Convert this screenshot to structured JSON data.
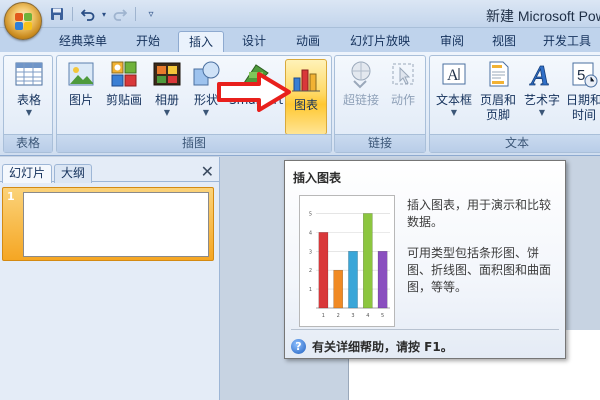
{
  "window": {
    "title": "新建 Microsoft PowerPoint 演示文稿",
    "title_visible": "新建 Microsoft Pow"
  },
  "quick_access": {
    "icons": [
      "save-icon",
      "undo-icon",
      "undo-dropdown-icon",
      "redo-icon",
      "customize-qat-icon"
    ]
  },
  "tabs": [
    {
      "label": "经典菜单"
    },
    {
      "label": "开始"
    },
    {
      "label": "插入",
      "active": true
    },
    {
      "label": "设计"
    },
    {
      "label": "动画"
    },
    {
      "label": "幻灯片放映"
    },
    {
      "label": "审阅"
    },
    {
      "label": "视图"
    },
    {
      "label": "开发工具"
    }
  ],
  "ribbon": {
    "groups": [
      {
        "label": "表格",
        "buttons": [
          {
            "label": "表格",
            "icon": "table-icon",
            "dropdown": true
          }
        ]
      },
      {
        "label": "插图",
        "buttons": [
          {
            "label": "图片",
            "icon": "picture-icon"
          },
          {
            "label": "剪贴画",
            "icon": "clipart-icon"
          },
          {
            "label": "相册",
            "icon": "photo-album-icon",
            "dropdown": true
          },
          {
            "label": "形状",
            "icon": "shapes-icon",
            "dropdown": true
          },
          {
            "label": "SmartArt",
            "icon": "smartart-icon"
          },
          {
            "label": "图表",
            "icon": "chart-icon",
            "highlighted": true
          }
        ]
      },
      {
        "label": "链接",
        "buttons": [
          {
            "label": "超链接",
            "icon": "hyperlink-icon",
            "disabled": true
          },
          {
            "label": "动作",
            "icon": "action-icon",
            "disabled": true
          }
        ]
      },
      {
        "label": "文本",
        "buttons": [
          {
            "label": "文本框",
            "icon": "textbox-icon",
            "dropdown": true
          },
          {
            "label": "页眉和",
            "label2": "页脚",
            "icon": "header-footer-icon"
          },
          {
            "label": "艺术字",
            "icon": "wordart-icon",
            "dropdown": true
          },
          {
            "label": "日期和",
            "label2": "时间",
            "icon": "date-time-icon"
          }
        ]
      }
    ]
  },
  "left_panel": {
    "tabs": [
      {
        "label": "幻灯片",
        "active": true
      },
      {
        "label": "大纲"
      }
    ],
    "close": "✕",
    "slides": [
      {
        "number": "1"
      }
    ]
  },
  "tooltip": {
    "title": "插入图表",
    "desc1": "插入图表，用于演示和比较数据。",
    "desc2": "可用类型包括条形图、饼图、折线图、面积图和曲面图，等等。",
    "help": "有关详细帮助，请按 F1。",
    "help_icon": "?",
    "preview_chart": {
      "type": "bar",
      "categories": [
        "1",
        "2",
        "3",
        "4",
        "5"
      ],
      "values": [
        4,
        2,
        3,
        5,
        3
      ],
      "y_ticks": [
        "1",
        "2",
        "3",
        "4",
        "5"
      ],
      "colors": [
        "#d9383a",
        "#f08a24",
        "#3aa6d8",
        "#8cc63f",
        "#8a4fbf"
      ]
    }
  },
  "colors": {
    "accent_highlight": "#ffd965",
    "ribbon_bg": "#e0eaf7",
    "arrow_red": "#e8201c",
    "slide_selected": "#f5a623"
  }
}
